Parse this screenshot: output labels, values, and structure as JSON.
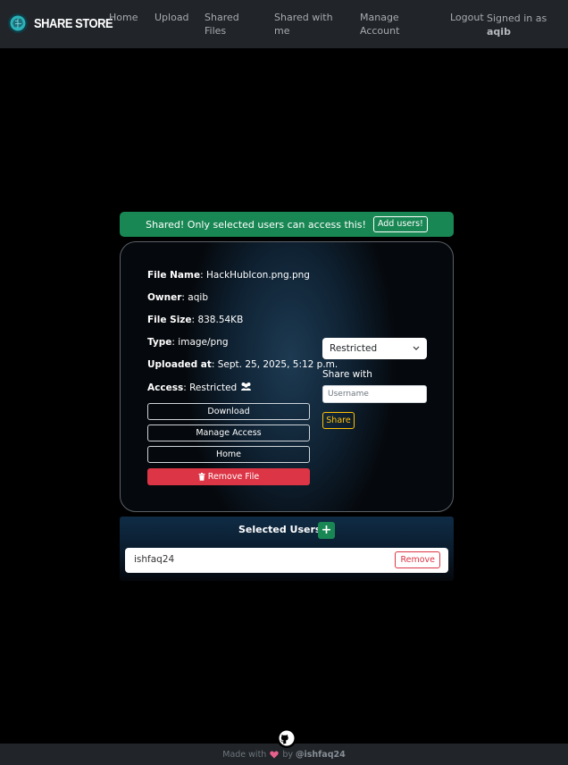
{
  "brand": {
    "name": "SHARE STORE"
  },
  "nav": {
    "home": "Home",
    "upload": "Upload",
    "shared_files_1": "Shared",
    "shared_files_2": "Files",
    "shared_with_me_1": "Shared with",
    "shared_with_me_2": "me",
    "manage_account_1": "Manage",
    "manage_account_2": "Account",
    "logout": "Logout",
    "signed_in_label": "Signed in as",
    "username": "aqib"
  },
  "alert": {
    "message": "Shared! Only selected users can access this!",
    "button": "Add users!"
  },
  "file": {
    "name_label": "File Name",
    "name": "HackHubIcon.png.png",
    "owner_label": "Owner",
    "owner": "aqib",
    "size_label": "File Size",
    "size": "838.54KB",
    "type_label": "Type",
    "type": "image/png",
    "uploaded_label": "Uploaded at",
    "uploaded": "Sept. 25, 2025, 5:12 p.m.",
    "access_label": "Access",
    "access": "Restricted"
  },
  "actions": {
    "download": "Download",
    "manage_access": "Manage Access",
    "home": "Home",
    "remove": "Remove File"
  },
  "sharing": {
    "access_select": "Restricted",
    "share_with_label": "Share with",
    "username_placeholder": "Username",
    "share_button": "Share"
  },
  "selected_users": {
    "title": "Selected Users",
    "users": [
      {
        "name": "ishfaq24",
        "remove_label": "Remove"
      }
    ]
  },
  "footer": {
    "made_with": "Made with",
    "by": "by",
    "author": "@ishfaq24"
  },
  "colors": {
    "success": "#198754",
    "danger": "#dc3545",
    "warning": "#ffc107",
    "navbar": "#212529"
  }
}
